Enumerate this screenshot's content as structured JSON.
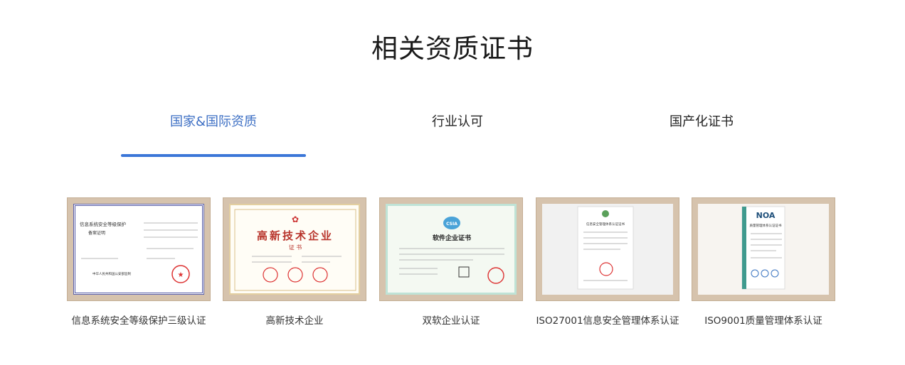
{
  "section": {
    "title": "相关资质证书"
  },
  "tabs": [
    {
      "label": "国家&国际资质",
      "active": true
    },
    {
      "label": "行业认可",
      "active": false
    },
    {
      "label": "国产化证书",
      "active": false
    }
  ],
  "cards": [
    {
      "caption": "信息系统安全等级保护三级认证",
      "cert_heading": "信息系统安全等级保护",
      "cert_subheading": "备案证明",
      "cert_footer": "中华人民共和国公安部监制"
    },
    {
      "caption": "高新技术企业",
      "cert_heading": "高新技术企业",
      "cert_subheading": "证 书"
    },
    {
      "caption": "双软企业认证",
      "cert_heading": "软件企业证书",
      "cert_badge": "CSIA"
    },
    {
      "caption": "ISO27001信息安全管理体系认证",
      "cert_heading": "信息安全管理体系认证证书"
    },
    {
      "caption": "ISO9001质量管理体系认证",
      "cert_logo": "NOA",
      "cert_heading": "质量管理体系认证证书"
    }
  ],
  "colors": {
    "accent": "#3b76d8",
    "active_tab": "#3d6fc4",
    "frame": "#d6c3ad",
    "seal_red": "#d33"
  }
}
